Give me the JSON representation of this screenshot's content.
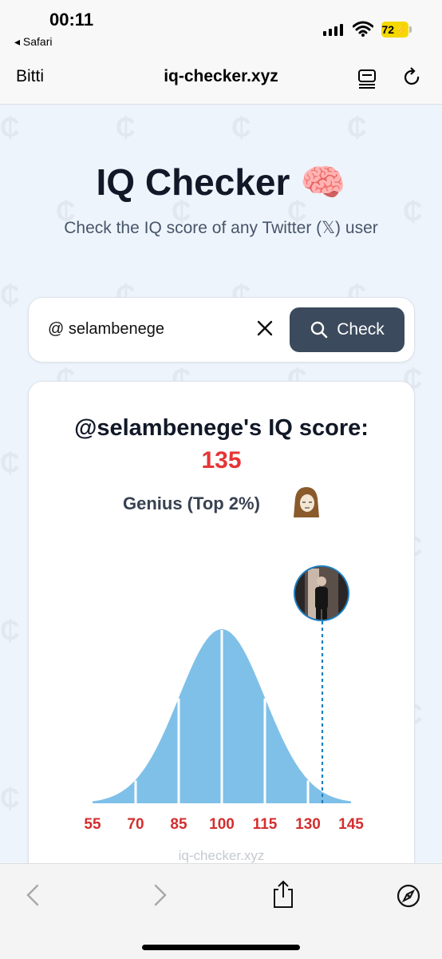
{
  "status_bar": {
    "time": "00:11",
    "back_app": "◂ Safari",
    "battery": "72",
    "battery_color": "#f5d800"
  },
  "browser": {
    "done_label": "Bitti",
    "url": "iq-checker.xyz",
    "reader_icon": "reader-icon",
    "reload_icon": "reload-icon"
  },
  "page": {
    "title": "IQ Checker 🧠",
    "subtitle": "Check the IQ score of any Twitter (𝕏) user",
    "search": {
      "value": "@ selambenege",
      "clear_icon": "close-icon",
      "button_label": "Check",
      "button_icon": "search-icon"
    },
    "result": {
      "title": "@selambenege's IQ score:",
      "score": "135",
      "category": "Genius (Top 2%)",
      "accent": "#e63535"
    },
    "watermark": "iq-checker.xyz"
  },
  "chart_data": {
    "type": "area",
    "title": "",
    "xlabel": "",
    "ylabel": "",
    "x_ticks": [
      "55",
      "70",
      "85",
      "100",
      "115",
      "130",
      "145"
    ],
    "xlim": [
      55,
      145
    ],
    "distribution": {
      "mean": 100,
      "sd": 15
    },
    "marker_value": 135,
    "fill_color": "#7ec0e8",
    "tick_label_color": "#d32f2f",
    "marker_color": "#1e7fc1"
  },
  "toolbar": {
    "back_icon": "chevron-left-icon",
    "forward_icon": "chevron-right-icon",
    "share_icon": "share-icon",
    "compass_icon": "compass-icon"
  }
}
